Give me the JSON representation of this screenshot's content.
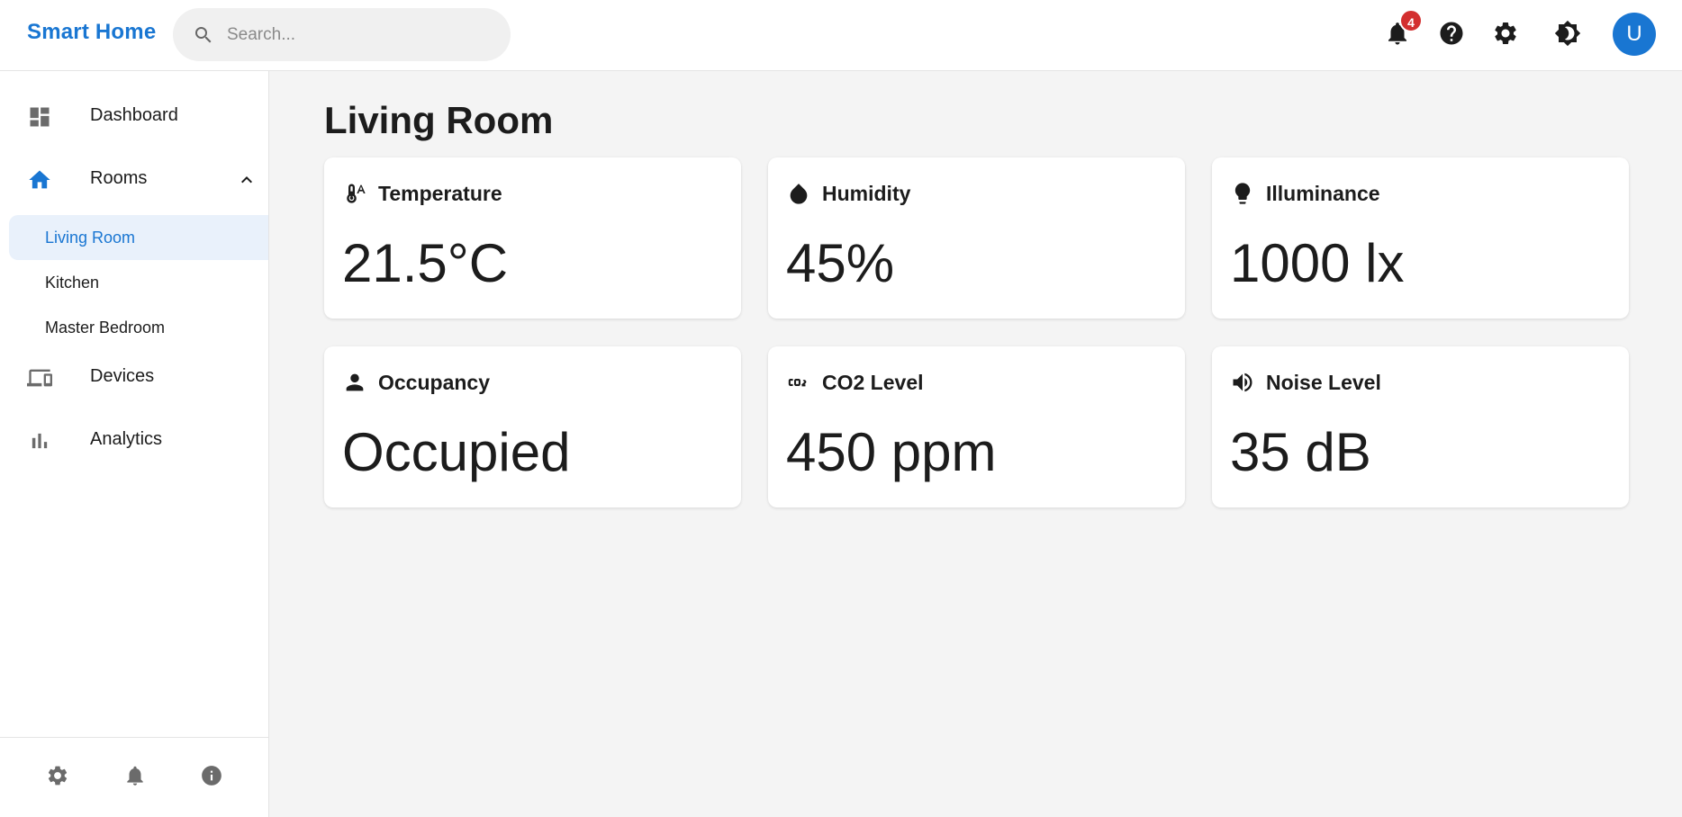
{
  "header": {
    "brand": "Smart Home",
    "search_placeholder": "Search...",
    "notification_count": "4",
    "avatar_initial": "U"
  },
  "sidebar": {
    "items": [
      {
        "label": "Dashboard",
        "icon": "dashboard-icon"
      },
      {
        "label": "Rooms",
        "icon": "home-icon",
        "expanded": true
      },
      {
        "label": "Devices",
        "icon": "devices-icon"
      },
      {
        "label": "Analytics",
        "icon": "bar-chart-icon"
      }
    ],
    "rooms": [
      {
        "label": "Living Room",
        "active": true
      },
      {
        "label": "Kitchen",
        "active": false
      },
      {
        "label": "Master Bedroom",
        "active": false
      }
    ],
    "footer_icons": [
      "settings-icon",
      "notifications-icon",
      "info-icon"
    ]
  },
  "main": {
    "title": "Living Room",
    "cards": [
      {
        "title": "Temperature",
        "value": "21.5°C",
        "icon": "thermometer-icon"
      },
      {
        "title": "Humidity",
        "value": "45%",
        "icon": "water-drop-icon"
      },
      {
        "title": "Illuminance",
        "value": "1000 lx",
        "icon": "lightbulb-icon"
      },
      {
        "title": "Occupancy",
        "value": "Occupied",
        "icon": "person-icon"
      },
      {
        "title": "CO2 Level",
        "value": "450 ppm",
        "icon": "co2-icon"
      },
      {
        "title": "Noise Level",
        "value": "35 dB",
        "icon": "volume-icon"
      }
    ]
  },
  "colors": {
    "accent": "#1976d2",
    "badge": "#d32f2f",
    "active_bg": "#e9f1fb",
    "page_bg": "#f4f4f4"
  }
}
